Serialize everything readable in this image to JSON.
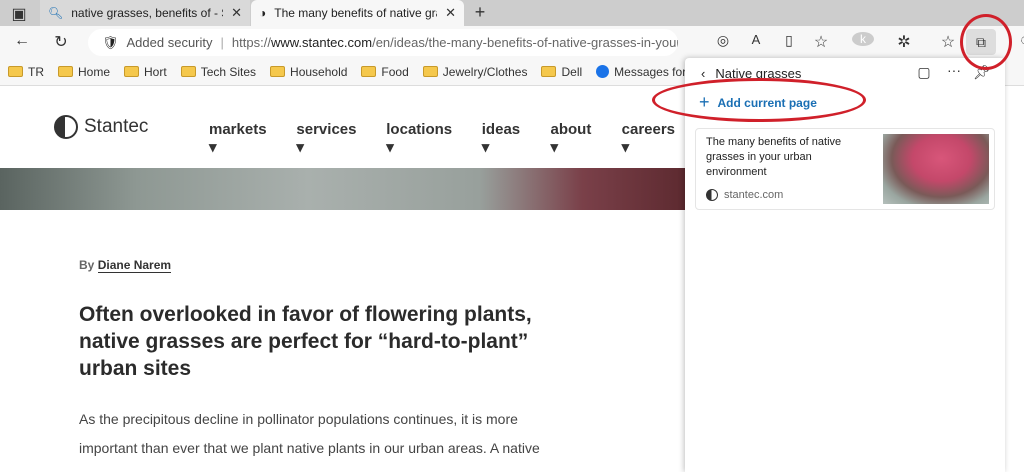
{
  "tabs": [
    {
      "title": "native grasses, benefits of - Search",
      "icon": "search-icon"
    },
    {
      "title": "The many benefits of native grasses",
      "icon": "stantec-icon"
    }
  ],
  "address": {
    "security": "Added security",
    "url_prefix": "https://",
    "url_domain": "www.stantec.com",
    "url_path": "/en/ideas/the-many-benefits-of-native-grasses-in-your-urba..."
  },
  "bookmarks": [
    "TR",
    "Home",
    "Hort",
    "Tech Sites",
    "Household",
    "Food",
    "Jewelry/Clothes",
    "Dell",
    "Messages for web"
  ],
  "site": {
    "brand": "Stantec",
    "nav": [
      "markets",
      "services",
      "locations",
      "ideas",
      "about",
      "careers"
    ],
    "by_label": "By",
    "author": "Diane Narem",
    "headline": "Often overlooked in favor of flowering plants, native grasses are perfect for “hard-to-plant” urban sites",
    "body": "As the precipitous decline in pollinator populations continues, it is more important than ever that we plant native plants in our urban areas. A native"
  },
  "collections": {
    "title": "Native grasses",
    "add_label": "Add current page",
    "card": {
      "title": "The many benefits of native grasses in your urban environment",
      "source": "stantec.com"
    }
  },
  "colors": {
    "annotation": "#d0202a",
    "link": "#1a6fb4"
  }
}
